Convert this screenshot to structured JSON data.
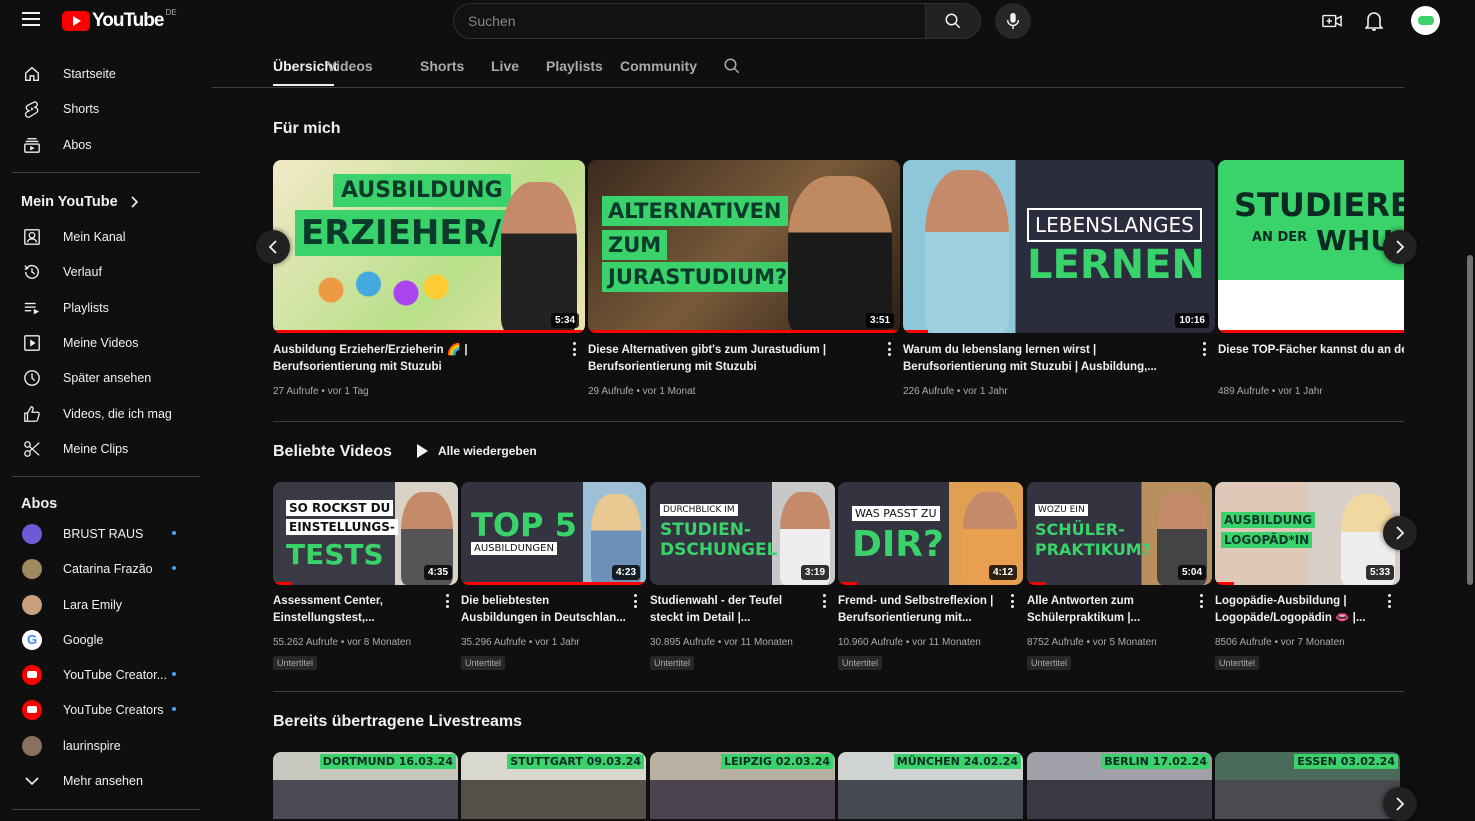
{
  "topbar": {
    "logo_word": "YouTube",
    "logo_region": "DE",
    "search_placeholder": "Suchen"
  },
  "sidebar": {
    "main": [
      "Startseite",
      "Shorts",
      "Abos"
    ],
    "my_youtube_heading": "Mein YouTube",
    "my_youtube": [
      "Mein Kanal",
      "Verlauf",
      "Playlists",
      "Meine Videos",
      "Später ansehen",
      "Videos, die ich mag",
      "Meine Clips"
    ],
    "subs_heading": "Abos",
    "subs": [
      {
        "name": "BRUST RAUS",
        "color": "#6b5bd6",
        "dot": true
      },
      {
        "name": "Catarina Frazão",
        "color": "#a08860",
        "dot": true
      },
      {
        "name": "Lara Emily",
        "color": "#c8a080",
        "dot": false
      },
      {
        "name": "Google",
        "color": "#ffffff",
        "dot": false
      },
      {
        "name": "YouTube Creator...",
        "color": "#ff0000",
        "dot": true
      },
      {
        "name": "YouTube Creators",
        "color": "#ff0000",
        "dot": true
      },
      {
        "name": "laurinspire",
        "color": "#8a7060",
        "dot": false
      }
    ],
    "more": "Mehr ansehen"
  },
  "tabs": [
    "Übersicht",
    "Videos",
    "Shorts",
    "Live",
    "Playlists",
    "Community"
  ],
  "for_me": {
    "title": "Für mich",
    "videos": [
      {
        "title": "Ausbildung Erzieher/Erzieherin 🌈 | Berufsorientierung mit Stuzubi",
        "views": "27 Aufrufe",
        "age": "vor 1 Tag",
        "duration": "5:34",
        "thumb_lines": [
          "AUSBILDUNG",
          "ERZIEHER/IN"
        ]
      },
      {
        "title": "Diese Alternativen gibt's zum Jurastudium | Berufsorientierung mit Stuzubi",
        "views": "29 Aufrufe",
        "age": "vor 1 Monat",
        "duration": "3:51",
        "thumb_lines": [
          "ALTERNATIVEN",
          "ZUM",
          "JURASTUDIUM?"
        ]
      },
      {
        "title": "Warum du lebenslang lernen wirst | Berufsorientierung mit Stuzubi | Ausbildung,...",
        "views": "226 Aufrufe",
        "age": "vor 1 Jahr",
        "duration": "10:16",
        "thumb_lines": [
          "LEBENSLANGES",
          "LERNEN"
        ]
      },
      {
        "title": "Diese TOP-Fächer kannst du an de Stuzubi Digital",
        "views": "489 Aufrufe",
        "age": "vor 1 Jahr",
        "duration": "",
        "thumb_lines": [
          "STUDIEREN",
          "AN DER",
          "WHU"
        ]
      }
    ]
  },
  "popular": {
    "title": "Beliebte Videos",
    "play_all": "Alle wiedergeben",
    "badge": "Untertitel",
    "videos": [
      {
        "title": "Assessment Center, Einstellungstest,...",
        "views": "55.262 Aufrufe",
        "age": "vor 8 Monaten",
        "duration": "4:35",
        "thumb_lines": [
          "SO ROCKST DU",
          "EINSTELLUNGS-",
          "TESTS"
        ]
      },
      {
        "title": "Die beliebtesten Ausbildungen in Deutschlan...",
        "views": "35.296 Aufrufe",
        "age": "vor 1 Jahr",
        "duration": "4:23",
        "thumb_lines": [
          "TOP 5",
          "AUSBILDUNGEN"
        ]
      },
      {
        "title": "Studienwahl - der Teufel steckt im Detail |...",
        "views": "30.895 Aufrufe",
        "age": "vor 11 Monaten",
        "duration": "3:19",
        "thumb_lines": [
          "DURCHBLICK IM",
          "STUDIEN-",
          "DSCHUNGEL"
        ]
      },
      {
        "title": "Fremd- und Selbstreflexion | Berufsorientierung mit...",
        "views": "10.960 Aufrufe",
        "age": "vor 11 Monaten",
        "duration": "4:12",
        "thumb_lines": [
          "WAS PASST ZU",
          "DIR?"
        ]
      },
      {
        "title": "Alle Antworten zum Schülerpraktikum |...",
        "views": "8752 Aufrufe",
        "age": "vor 5 Monaten",
        "duration": "5:04",
        "thumb_lines": [
          "WOZU EIN",
          "SCHÜLER-",
          "PRAKTIKUM?"
        ]
      },
      {
        "title": "Logopädie-Ausbildung | Logopäde/Logopädin 👄 |...",
        "views": "8506 Aufrufe",
        "age": "vor 7 Monaten",
        "duration": "5:33",
        "thumb_lines": [
          "AUSBILDUNG",
          "LOGOPÄD*IN"
        ]
      }
    ]
  },
  "livestreams": {
    "title": "Bereits übertragene Livestreams",
    "items": [
      "DORTMUND 16.03.24",
      "STUTTGART 09.03.24",
      "LEIPZIG 02.03.24",
      "MÜNCHEN 24.02.24",
      "BERLIN 17.02.24",
      "ESSEN 03.02.24"
    ]
  },
  "colors": {
    "accent_green": "#3ad26a",
    "brand_red": "#ff0000",
    "bg": "#0f0f0f"
  }
}
